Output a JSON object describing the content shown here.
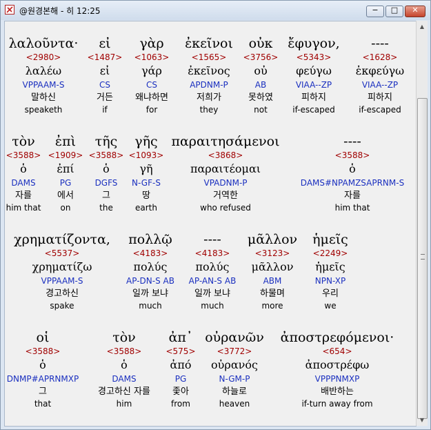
{
  "window": {
    "title": "@원경본해 - 히 12:25",
    "buttons": {
      "minimize": "−",
      "maximize": "□",
      "close": "✕"
    }
  },
  "rows": [
    {
      "words": [
        {
          "greek": "λαλοῦντα·",
          "strong": "<2980>",
          "lemma": "λαλέω",
          "parsing": "VPPAAM-S",
          "korean": "말하신",
          "english": "speaketh"
        },
        {
          "greek": "εἰ",
          "strong": "<1487>",
          "lemma": "εἰ",
          "parsing": "CS",
          "korean": "거든",
          "english": "if"
        },
        {
          "greek": "γὰρ",
          "strong": "<1063>",
          "lemma": "γάρ",
          "parsing": "CS",
          "korean": "왜냐하면",
          "english": "for"
        },
        {
          "greek": "ἐκεῖνοι",
          "strong": "<1565>",
          "lemma": "ἐκεῖνος",
          "parsing": "APDNM-P",
          "korean": "저희가",
          "english": "they"
        },
        {
          "greek": "οὐκ",
          "strong": "<3756>",
          "lemma": "οὐ",
          "parsing": "AB",
          "korean": "못하였",
          "english": "not"
        },
        {
          "greek": "ἔφυγον,",
          "strong": "<5343>",
          "lemma": "φεύγω",
          "parsing": "VIAA--ZP",
          "korean": "피하지",
          "english": "if-escaped"
        },
        {
          "greek": "----",
          "strong": "<1628>",
          "lemma": "ἐκφεύγω",
          "parsing": "VIAA--ZP",
          "korean": "피하지",
          "english": "if-escaped"
        }
      ]
    },
    {
      "words": [
        {
          "greek": "τὸν",
          "strong": "<3588>",
          "lemma": "ὁ",
          "parsing": "DAMS",
          "korean": "자를",
          "english": "him that"
        },
        {
          "greek": "ἐπὶ",
          "strong": "<1909>",
          "lemma": "ἐπί",
          "parsing": "PG",
          "korean": "에서",
          "english": "on"
        },
        {
          "greek": "τῆς",
          "strong": "<3588>",
          "lemma": "ὁ",
          "parsing": "DGFS",
          "korean": "그",
          "english": "the"
        },
        {
          "greek": "γῆς",
          "strong": "<1093>",
          "lemma": "γῆ",
          "parsing": "N-GF-S",
          "korean": "땅",
          "english": "earth"
        },
        {
          "greek": "παραιτησάμενοι",
          "strong": "<3868>",
          "lemma": "παραιτέομαι",
          "parsing": "VPADNM-P",
          "korean": "거역한",
          "english": "who refused"
        },
        {
          "greek": "----",
          "strong": "<3588>",
          "lemma": "ὁ",
          "parsing": "DAMS#NPAMZSAPRNM-S",
          "korean": "자를",
          "english": "him that"
        }
      ]
    },
    {
      "words": [
        {
          "greek": "χρηματίζοντα,",
          "strong": "<5537>",
          "lemma": "χρηματίζω",
          "parsing": "VPPAAM-S",
          "korean": "경고하신",
          "english": "spake"
        },
        {
          "greek": "πολλῷ",
          "strong": "<4183>",
          "lemma": "πολύς",
          "parsing": "AP-DN-S AB",
          "korean": "일까 보냐",
          "english": "much"
        },
        {
          "greek": "----",
          "strong": "<4183>",
          "lemma": "πολύς",
          "parsing": "AP-AN-S AB",
          "korean": "일까 보냐",
          "english": "much"
        },
        {
          "greek": "μᾶλλον",
          "strong": "<3123>",
          "lemma": "μᾶλλον",
          "parsing": "ABM",
          "korean": "하물며",
          "english": "more"
        },
        {
          "greek": "ἡμεῖς",
          "strong": "<2249>",
          "lemma": "ἡμεῖς",
          "parsing": "NPN-XP",
          "korean": "우리",
          "english": "we"
        }
      ]
    },
    {
      "words": [
        {
          "greek": "οἱ",
          "strong": "<3588>",
          "lemma": "ὁ",
          "parsing": "DNMP#APRNMXP",
          "korean": "그",
          "english": "that"
        },
        {
          "greek": "τὸν",
          "strong": "<3588>",
          "lemma": "ὁ",
          "parsing": "DAMS",
          "korean": "경고하신 자를",
          "english": "him"
        },
        {
          "greek": "ἀπ᾽",
          "strong": "<575>",
          "lemma": "ἀπό",
          "parsing": "PG",
          "korean": "좇아",
          "english": "from"
        },
        {
          "greek": "οὐρανῶν",
          "strong": "<3772>",
          "lemma": "οὐρανός",
          "parsing": "N-GM-P",
          "korean": "하늘로",
          "english": "heaven"
        },
        {
          "greek": "ἀποστρεφόμενοι·",
          "strong": "<654>",
          "lemma": "ἀποστρέφω",
          "parsing": "VPPPNMXP",
          "korean": "배반하는",
          "english": "if-turn away from"
        }
      ]
    }
  ],
  "colors": {
    "strong": "#a00000",
    "parsing": "#1a2fbf",
    "text": "#000000",
    "background": "#f0f0f0"
  },
  "icons": {
    "app": "app-logo-icon",
    "scroll_up": "chevron-up-icon",
    "scroll_down": "chevron-down-icon"
  }
}
